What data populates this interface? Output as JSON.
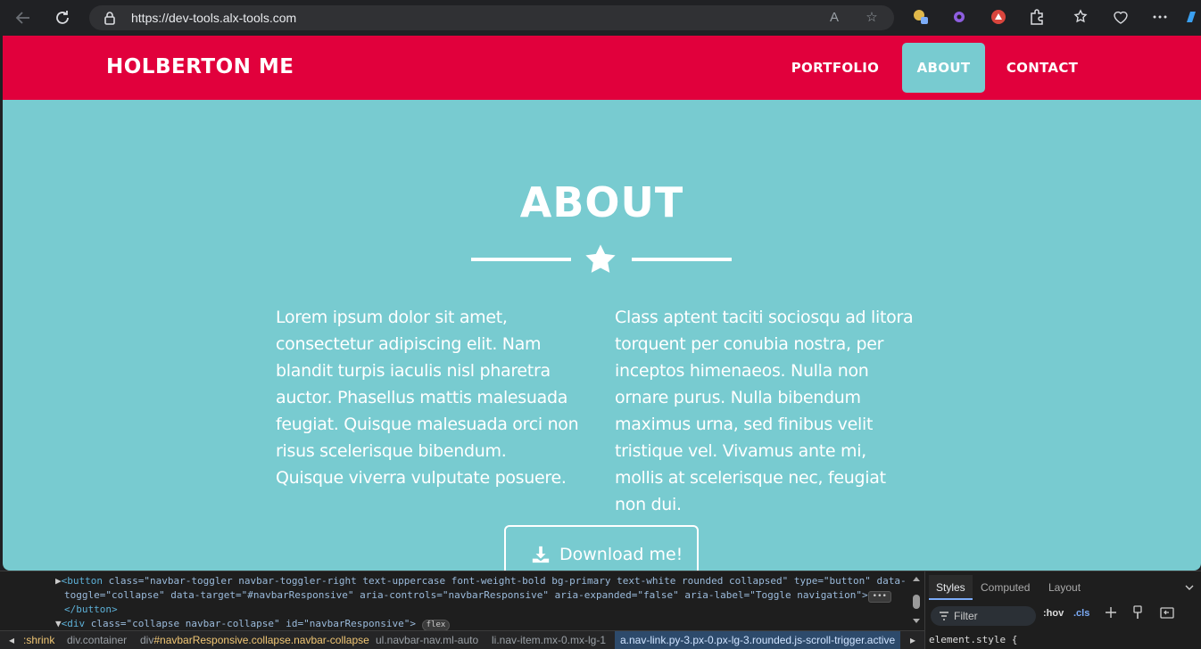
{
  "browser": {
    "url": "https://dev-tools.alx-tools.com"
  },
  "navbar": {
    "brand": "HOLBERTON ME",
    "links": [
      {
        "label": "PORTFOLIO",
        "active": false
      },
      {
        "label": "ABOUT",
        "active": true
      },
      {
        "label": "CONTACT",
        "active": false
      }
    ]
  },
  "about": {
    "title": "ABOUT",
    "col_left": "Lorem ipsum dolor sit amet, consectetur adipiscing elit. Nam blandit turpis iaculis nisl pharetra auctor. Phasellus mattis malesuada feugiat. Quisque malesuada orci non risus scelerisque bibendum. Quisque viverra vulputate posuere.",
    "col_right": "Class aptent taciti sociosqu ad litora torquent per conubia nostra, per inceptos himenaeos. Nulla non ornare purus. Nulla bibendum maximus urna, sed finibus velit tristique vel. Vivamus ante mi, mollis at scelerisque nec, feugiat non dui.",
    "download_label": "Download me!"
  },
  "colors": {
    "navbar_bg": "#e1003c",
    "page_bg": "#78cbd0",
    "text": "#ffffff"
  },
  "devtools": {
    "dom": {
      "line1_tag": "<button",
      "line1_attrs": " class=\"navbar-toggler navbar-toggler-right text-uppercase font-weight-bold bg-primary text-white rounded collapsed\" type=\"button\" data-",
      "line2": "toggle=\"collapse\" data-target=\"#navbarResponsive\" aria-controls=\"navbarResponsive\" aria-expanded=\"false\" aria-label=\"Toggle navigation\">",
      "line3": "</button>",
      "line4_tag": "<div",
      "line4_attrs": " class=\"collapse navbar-collapse\" id=\"navbarResponsive\">",
      "badge": "flex"
    },
    "breadcrumbs": {
      "c1": ":shrink",
      "c2": "div.container",
      "c3a": "div",
      "c3b": "#navbarResponsive.collapse.navbar-collapse",
      "c4": "ul.navbar-nav.ml-auto",
      "c5": "li.nav-item.mx-0.mx-lg-1",
      "c6": "a.nav-link.py-3.px-0.px-lg-3.rounded.js-scroll-trigger.active"
    },
    "tabs": [
      "Styles",
      "Computed",
      "Layout"
    ],
    "filter_placeholder": "Filter",
    "hov": ":hov",
    "cls": ".cls",
    "element_style": "element.style {"
  }
}
